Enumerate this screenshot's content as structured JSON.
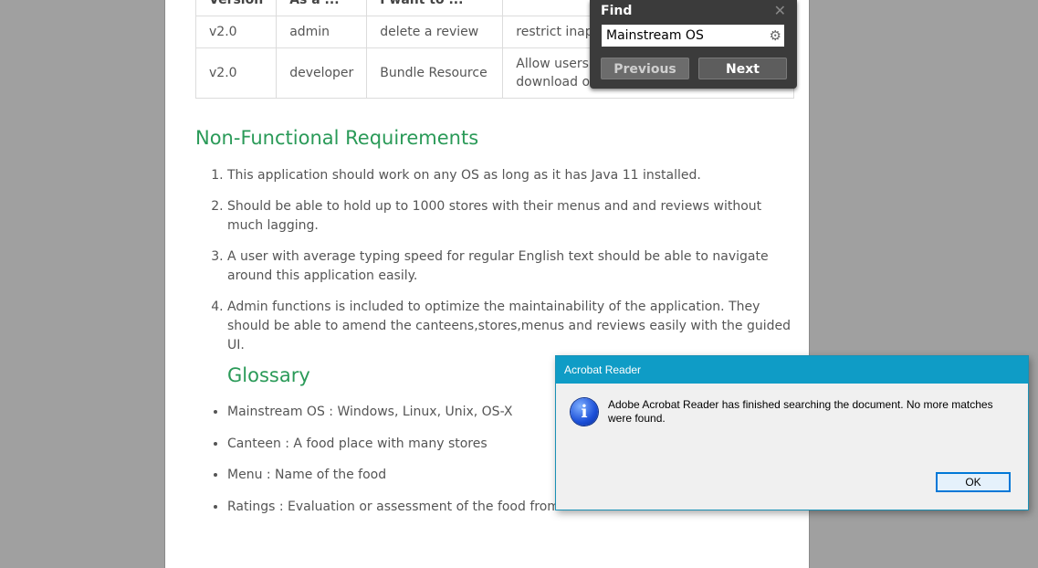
{
  "table": {
    "headers": [
      "Version",
      "As a ...",
      "I want to ...",
      ""
    ],
    "rows": [
      [
        "v2.0",
        "admin",
        "delete a review",
        "restrict inappro"
      ],
      [
        "v2.0",
        "developer",
        "Bundle Resource",
        "Allow users to",
        "download of ap"
      ]
    ]
  },
  "nfr": {
    "heading": "Non-Functional Requirements",
    "items": [
      "This application should work on any OS as long as it has Java 11 installed.",
      "Should be able to hold up to 1000 stores with their menus and and reviews without much lagging.",
      "A user with average typing speed for regular English text should be able to navigate around this application easily.",
      "Admin functions is included to optimize the maintainability of the application. They should be able to amend the canteens,stores,menus and reviews easily with the guided UI."
    ]
  },
  "glossary": {
    "heading": "Glossary",
    "items": [
      "Mainstream OS : Windows, Linux, Unix, OS-X",
      "Canteen : A food place with many stores",
      "Menu : Name of the food",
      "Ratings : Evaluation or assessment of the food from a store"
    ]
  },
  "find": {
    "title": "Find",
    "query": "Mainstream OS",
    "previous_label": "Previous",
    "next_label": "Next"
  },
  "dialog": {
    "title": "Acrobat Reader",
    "message": "Adobe Acrobat Reader has finished searching the document. No more matches were found.",
    "ok_label": "OK"
  }
}
